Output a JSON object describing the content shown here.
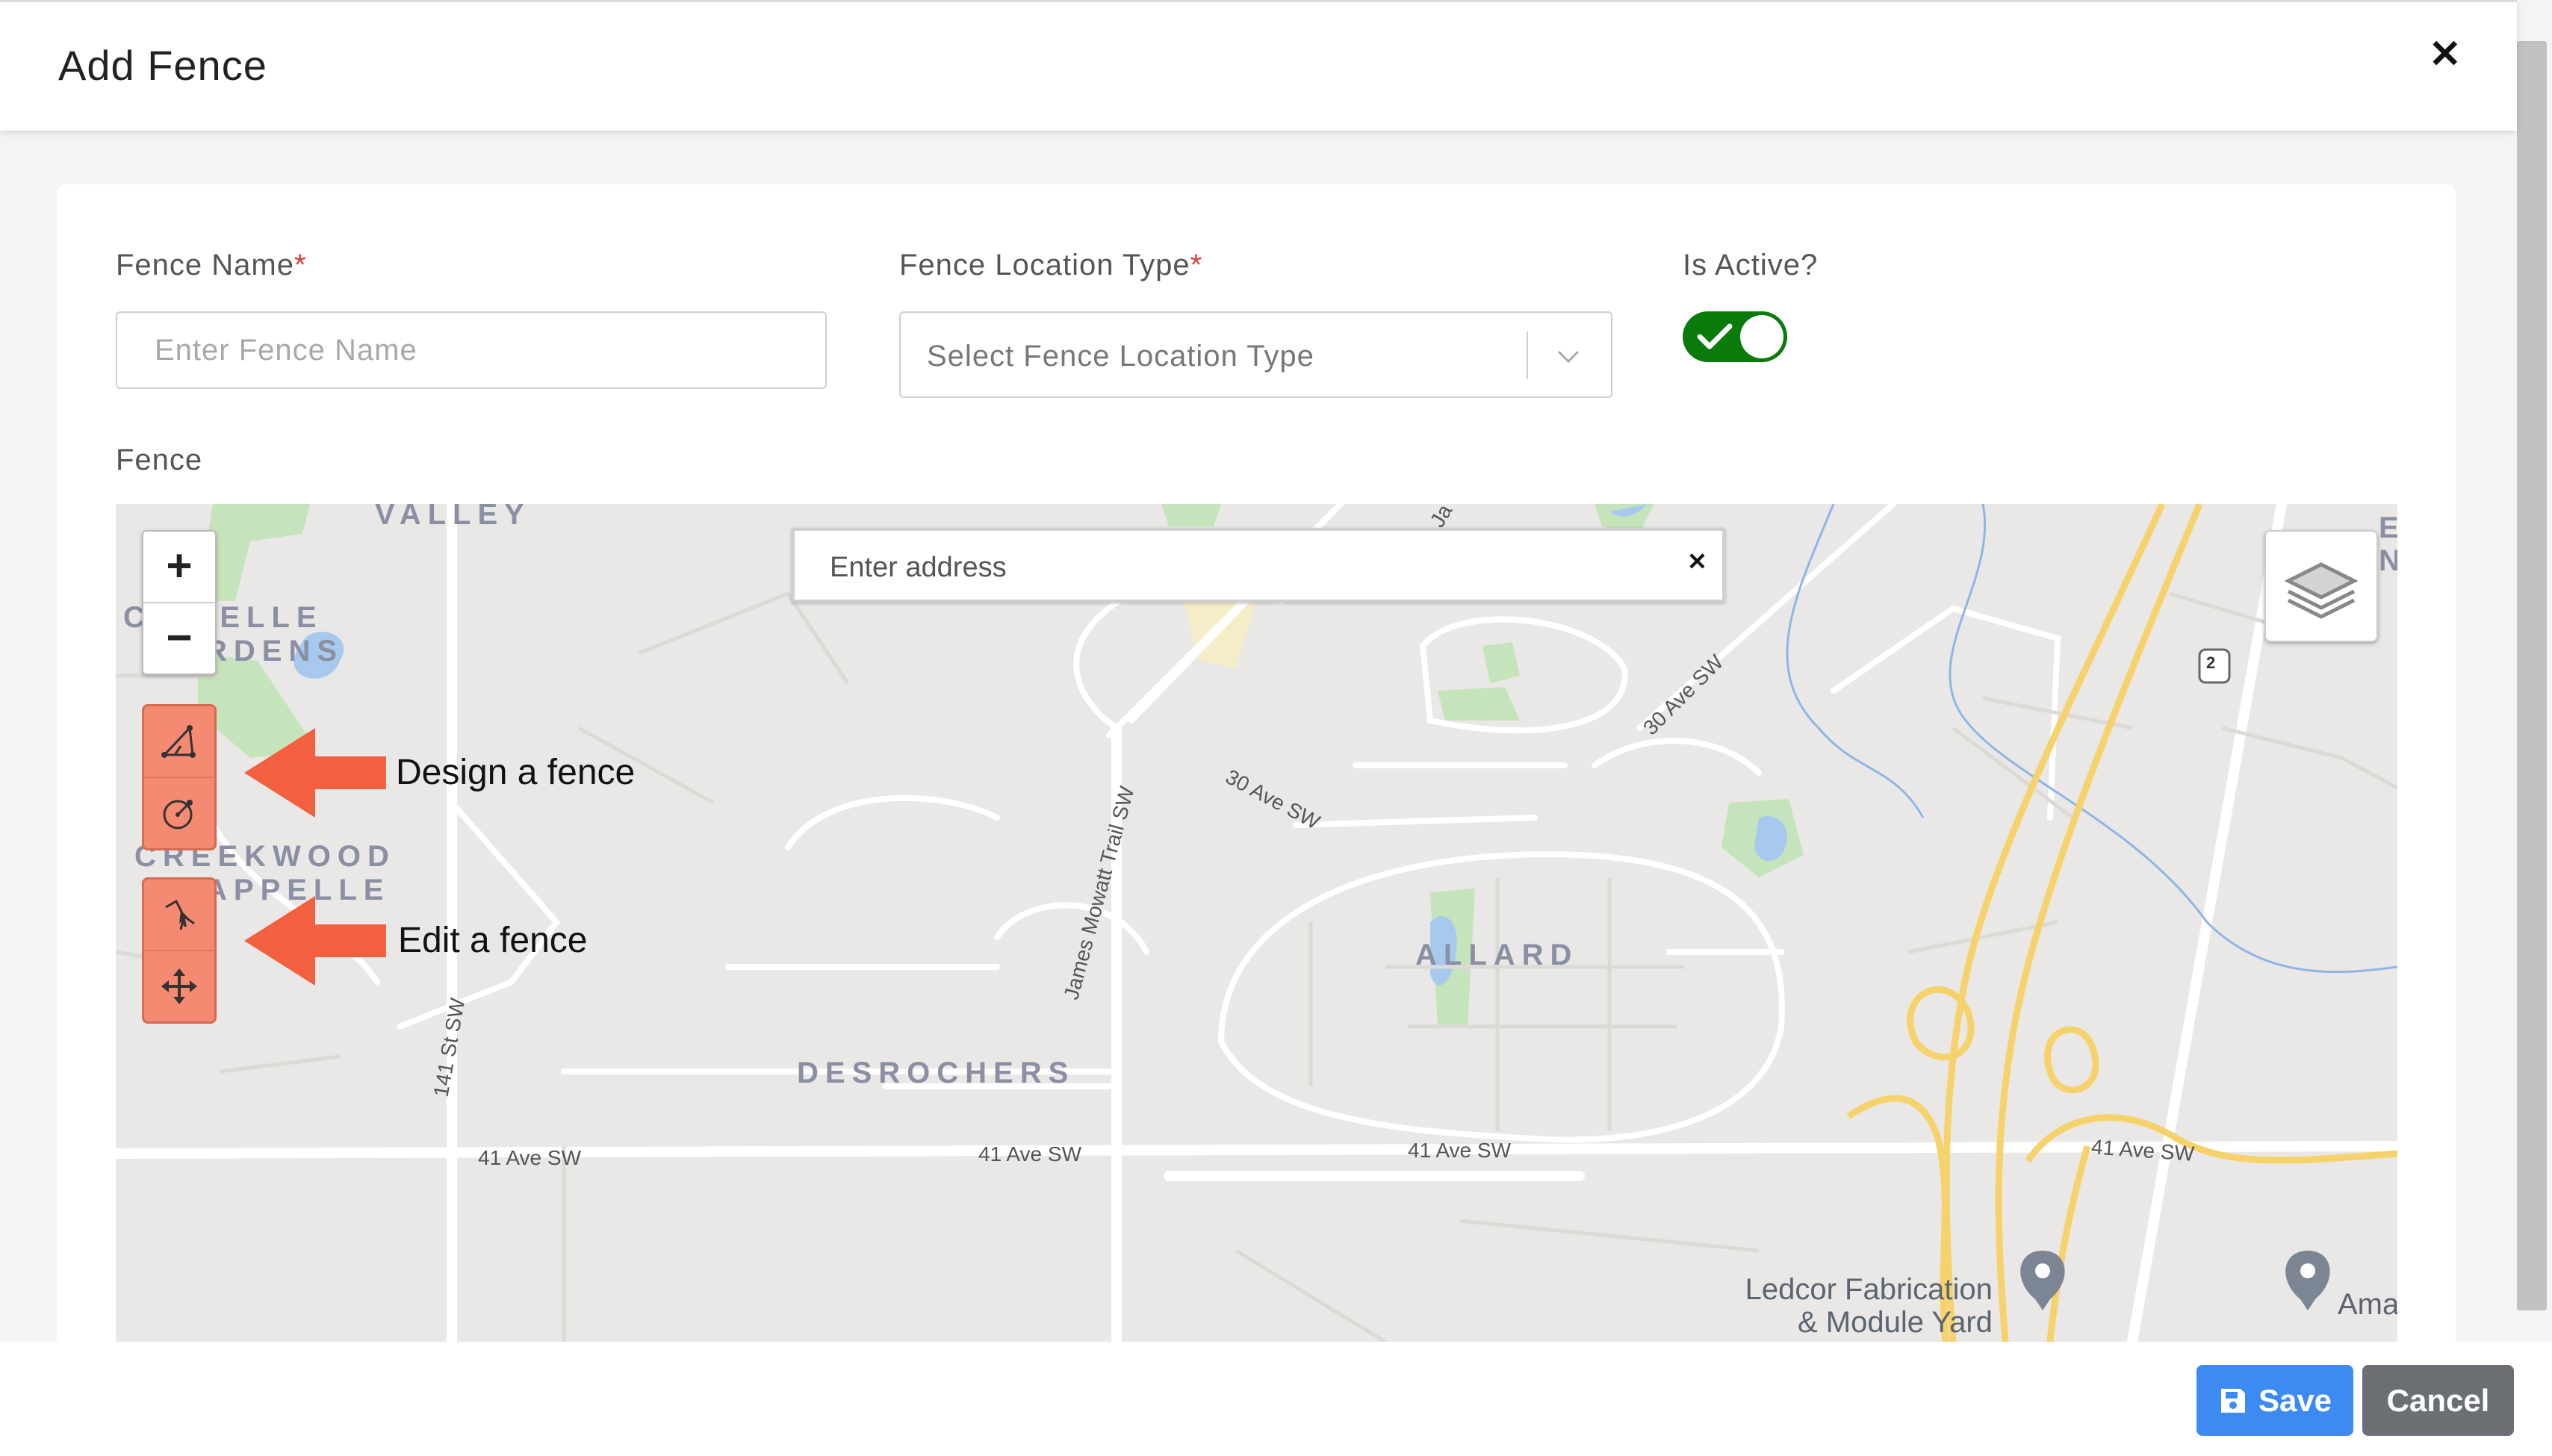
{
  "dialog": {
    "title": "Add Fence"
  },
  "form": {
    "fence_name": {
      "label": "Fence Name",
      "required_mark": "*",
      "placeholder": "Enter Fence Name"
    },
    "location_type": {
      "label": "Fence Location Type",
      "required_mark": "*",
      "placeholder": "Select Fence Location Type"
    },
    "is_active": {
      "label": "Is Active?",
      "value": true
    },
    "fence_section_label": "Fence"
  },
  "map": {
    "address_placeholder": "Enter address",
    "zoom_in": "+",
    "zoom_out": "−",
    "annotations": {
      "design": "Design a fence",
      "edit": "Edit a fence"
    },
    "areas": {
      "valley": "VALLEY",
      "chappelle_1": "C  PPELLE",
      "chappelle_2": " RDENS",
      "creekwood_1": "CREEKWOOD",
      "creekwood_2": "  APPELLE",
      "allard": "ALLARD",
      "desrochers": "DESROCHERS"
    },
    "streets": {
      "ave41_a": "41 Ave SW",
      "ave41_b": "41 Ave SW",
      "ave41_c": "41 Ave SW",
      "ave41_d": "41 Ave SW",
      "ave30_a": "30 Ave SW",
      "ave30_b": "30 Ave SW",
      "james": "James Mowatt Trail SW",
      "st141": "141 St SW",
      "ja": "Ja"
    },
    "highway_shield": "2",
    "corner_letters": "E\nN",
    "pois": {
      "ledcor_1": "Ledcor Fabrication",
      "ledcor_2": "& Module Yard",
      "ama": "Ama"
    },
    "colors": {
      "tool_bg": "#f58a73",
      "arrow": "#f2603f",
      "water": "#a8c9ee",
      "park": "#c6e4bb",
      "highway": "#f5d26b"
    }
  },
  "footer": {
    "save_label": "Save",
    "cancel_label": "Cancel"
  },
  "colors": {
    "toggle_on": "#0a7a0a",
    "save": "#3d8bf2",
    "cancel": "#6b6f73",
    "required": "#e53935"
  }
}
